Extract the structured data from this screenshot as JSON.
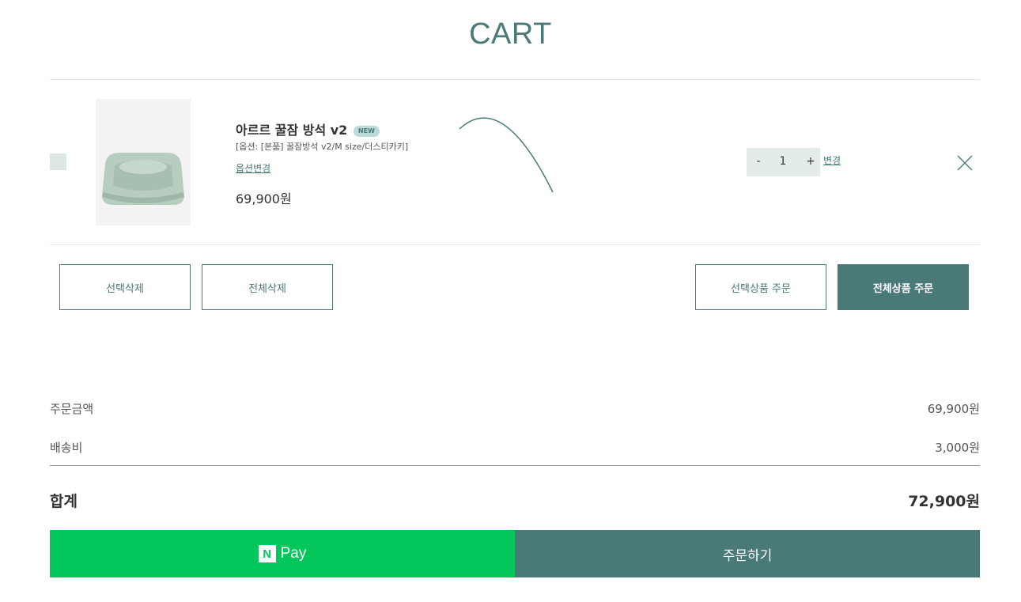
{
  "page": {
    "title": "CART"
  },
  "item": {
    "name": "아르르 꿀잠 방석 v2",
    "badge": "NEW",
    "option": "[옵션: [본품] 꿀잠방석 v2/M size/더스티카키]",
    "option_change_label": "옵션변경",
    "price": "69,900원",
    "quantity": "1",
    "qty_minus": "-",
    "qty_plus": "+",
    "qty_change_label": "변경"
  },
  "actions": {
    "delete_selected": "선택삭제",
    "delete_all": "전체삭제",
    "order_selected": "선택상품 주문",
    "order_all": "전체상품 주문"
  },
  "summary": {
    "order_amount_label": "주문금액",
    "order_amount": "69,900원",
    "shipping_label": "배송비",
    "shipping": "3,000원",
    "total_label": "합계",
    "total": "72,900원"
  },
  "checkout": {
    "npay_logo": "N",
    "npay_label": "Pay",
    "order_label": "주문하기"
  },
  "colors": {
    "accent": "#4a7a78",
    "npay_green": "#03c75a",
    "checkbox_bg": "#dde8e6",
    "badge_bg": "#b9dcd6"
  }
}
